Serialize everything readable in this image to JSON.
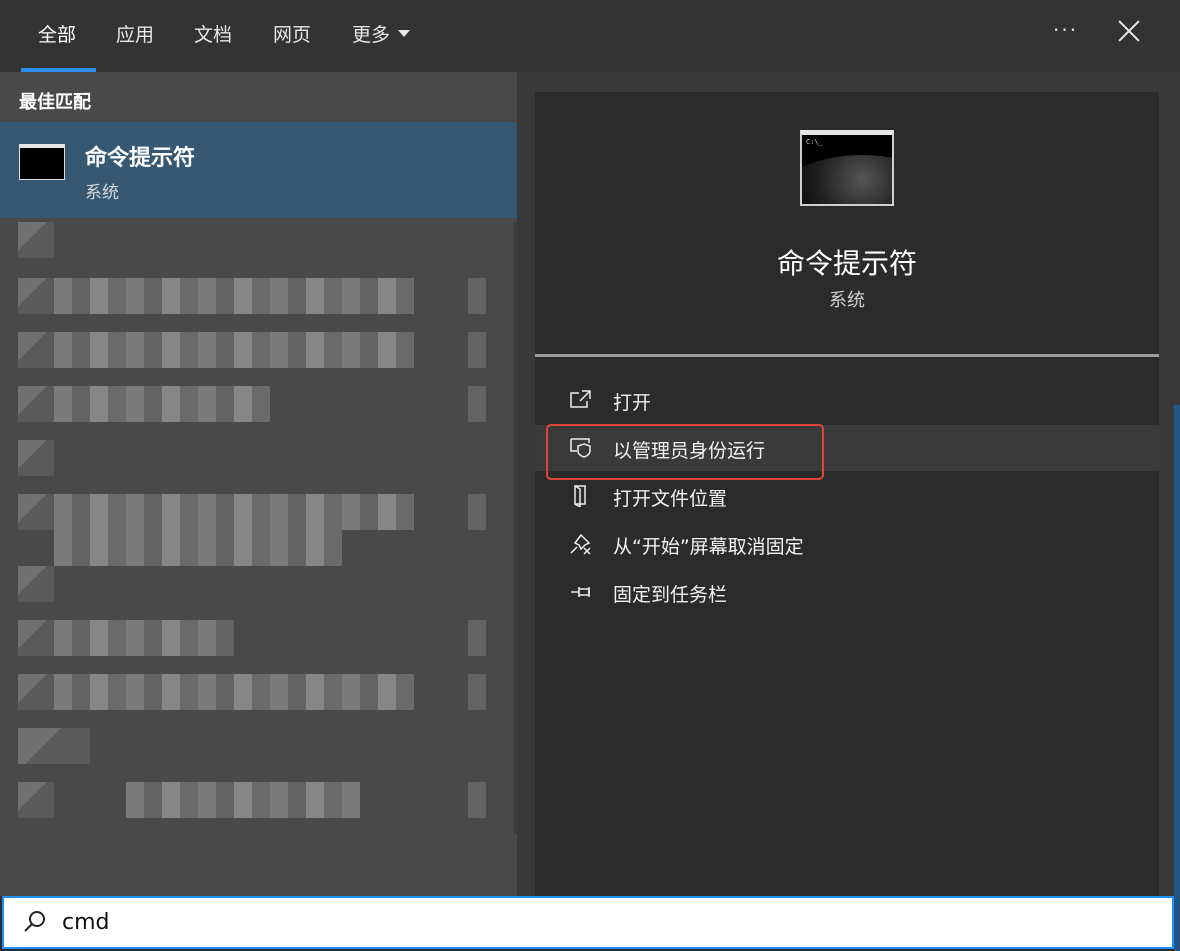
{
  "tabs": [
    {
      "label": "全部",
      "active": true
    },
    {
      "label": "应用",
      "active": false
    },
    {
      "label": "文档",
      "active": false
    },
    {
      "label": "网页",
      "active": false
    },
    {
      "label": "更多",
      "active": false
    }
  ],
  "header": {
    "more_dots": "···"
  },
  "left": {
    "section_title": "最佳匹配",
    "best_match": {
      "name": "命令提示符",
      "subtitle": "系统",
      "icon": "cmd-window-icon"
    }
  },
  "right": {
    "title": "命令提示符",
    "subtitle": "系统",
    "actions": [
      {
        "label": "打开",
        "icon": "open-external-icon"
      },
      {
        "label": "以管理员身份运行",
        "icon": "shield-admin-icon",
        "highlighted": true
      },
      {
        "label": "打开文件位置",
        "icon": "file-location-icon"
      },
      {
        "label": "从“开始”屏幕取消固定",
        "icon": "unpin-icon"
      },
      {
        "label": "固定到任务栏",
        "icon": "pin-taskbar-icon"
      }
    ]
  },
  "search": {
    "query": "cmd",
    "icon": "search-icon"
  },
  "colors": {
    "accent": "#2f8ff0",
    "selected": "#365873",
    "highlight_box": "#e0453a"
  }
}
